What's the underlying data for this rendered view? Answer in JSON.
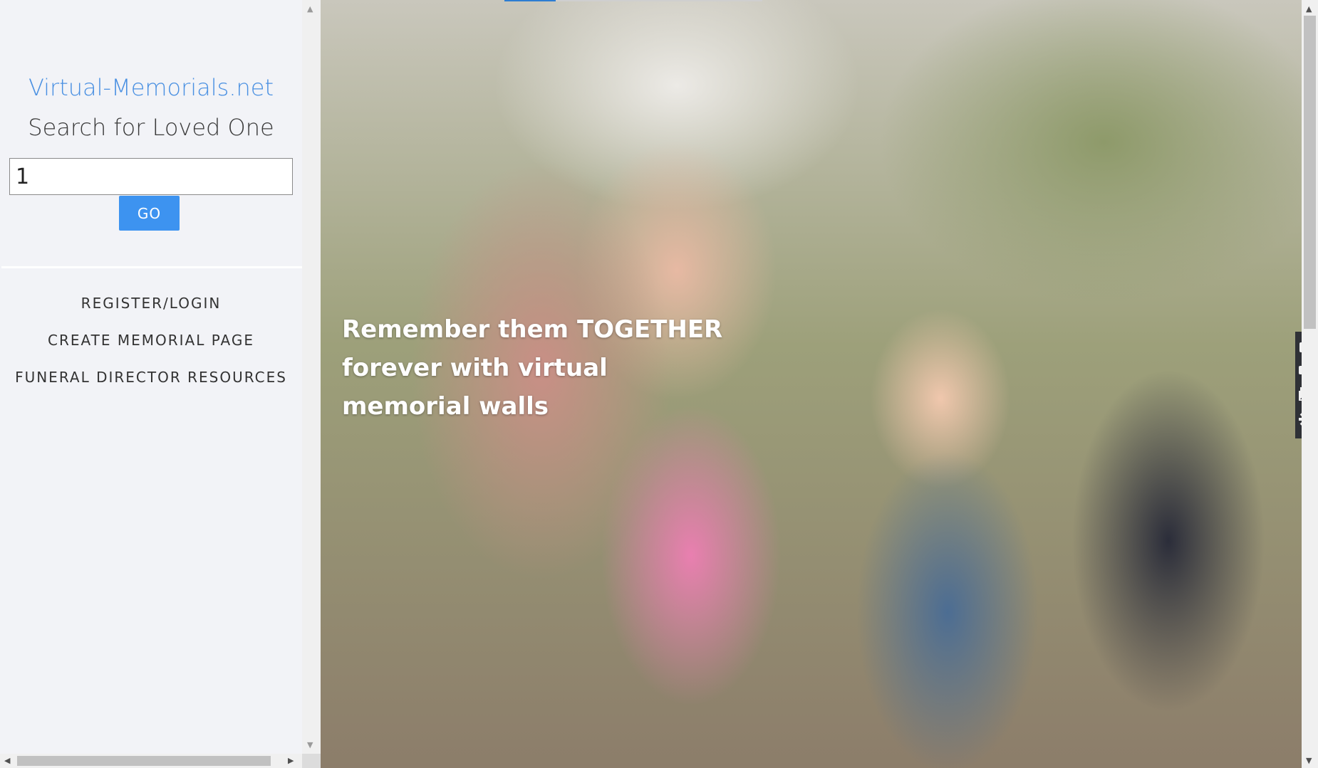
{
  "sidebar": {
    "site_title": "Virtual-Memorials.net",
    "search_heading": "Search for Loved One",
    "search_value": "1",
    "go_label": "GO",
    "nav_items": [
      {
        "label": "REGISTER/LOGIN"
      },
      {
        "label": "CREATE MEMORIAL PAGE"
      },
      {
        "label": "FUNERAL DIRECTOR RESOURCES"
      }
    ]
  },
  "hero": {
    "tagline": "Remember them TOGETHER forever with virtual memorial walls"
  },
  "tools": {
    "icons": [
      "camera-icon",
      "video-camera-icon",
      "gallery-icon",
      "gear-icon"
    ]
  },
  "colors": {
    "accent": "#3d93f0",
    "title_blue": "#4a90e2",
    "sidebar_bg": "#f2f3f7"
  }
}
